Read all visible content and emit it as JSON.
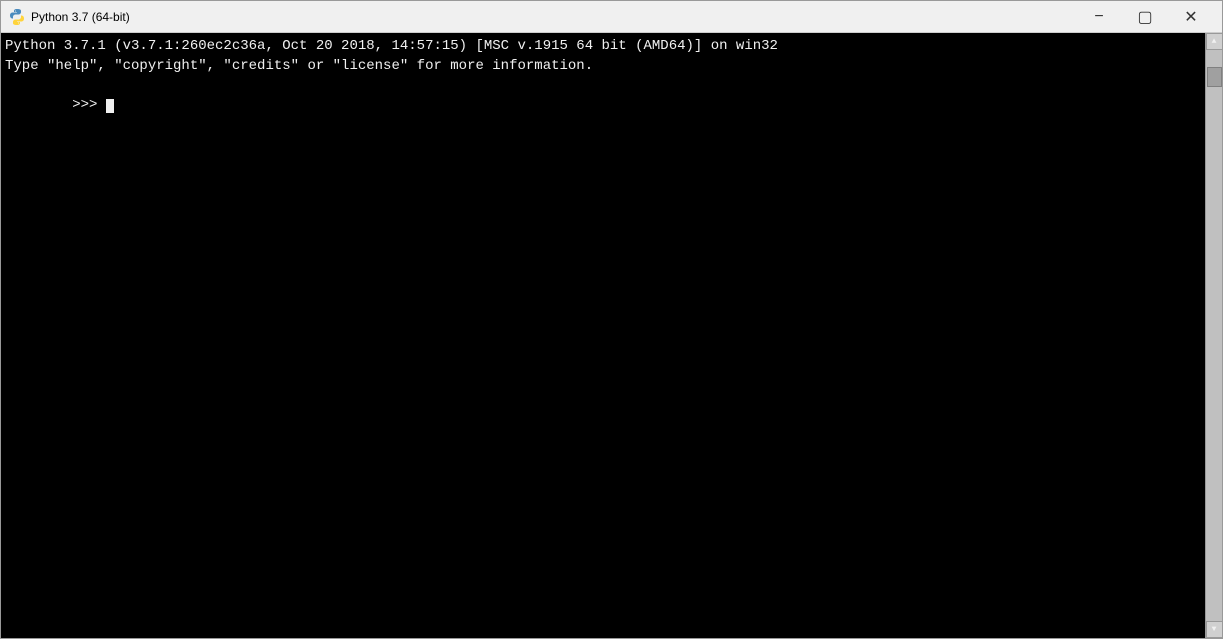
{
  "titleBar": {
    "icon": "python-icon",
    "title": "Python 3.7 (64-bit)",
    "minimizeLabel": "minimize",
    "maximizeLabel": "maximize",
    "closeLabel": "close"
  },
  "console": {
    "line1": "Python 3.7.1 (v3.7.1:260ec2c36a, Oct 20 2018, 14:57:15) [MSC v.1915 64 bit (AMD64)] on win32",
    "line2": "Type \"help\", \"copyright\", \"credits\" or \"license\" for more information.",
    "line3": ">>> "
  }
}
